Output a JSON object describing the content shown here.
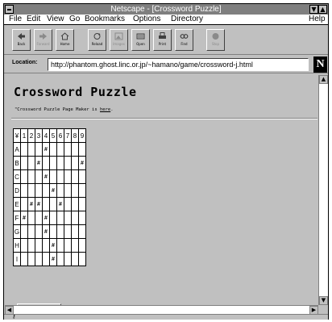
{
  "window": {
    "title": "Netscape - [Crossword Puzzle]"
  },
  "menu": [
    "File",
    "Edit",
    "View",
    "Go",
    "Bookmarks",
    "Options",
    "Directory",
    "Help"
  ],
  "toolbar": [
    {
      "label": "Back",
      "icon": "back-arrow-icon",
      "enabled": true
    },
    {
      "label": "Forward",
      "icon": "forward-arrow-icon",
      "enabled": false
    },
    {
      "label": "Home",
      "icon": "home-icon",
      "enabled": true
    },
    {
      "label": "Reload",
      "icon": "reload-icon",
      "enabled": true
    },
    {
      "label": "Images",
      "icon": "images-icon",
      "enabled": false
    },
    {
      "label": "Open",
      "icon": "open-icon",
      "enabled": true
    },
    {
      "label": "Print",
      "icon": "print-icon",
      "enabled": true
    },
    {
      "label": "Find",
      "icon": "find-icon",
      "enabled": true
    },
    {
      "label": "Stop",
      "icon": "stop-icon",
      "enabled": false
    }
  ],
  "location": {
    "label": "Location:",
    "url": "http://phantom.ghost.linc.or.jp/~hamano/game/crossword-j.html"
  },
  "logo": "N",
  "page": {
    "title": "Crossword Puzzle",
    "note_before": "\"Crossword Puzzle Page Maker is ",
    "note_link": "here",
    "note_after": "."
  },
  "puzzle": {
    "corner": "¥",
    "col_headers": [
      "1",
      "2",
      "3",
      "4",
      "5",
      "6",
      "7",
      "8",
      "9"
    ],
    "rows": [
      {
        "label": "A",
        "cells": [
          "",
          "",
          "",
          "#",
          "",
          "",
          "",
          "",
          ""
        ]
      },
      {
        "label": "B",
        "cells": [
          "",
          "",
          "#",
          "",
          "",
          "",
          "",
          "",
          "#"
        ]
      },
      {
        "label": "C",
        "cells": [
          "",
          "",
          "",
          "#",
          "",
          "",
          "",
          "",
          ""
        ]
      },
      {
        "label": "D",
        "cells": [
          "",
          "",
          "",
          "",
          "#",
          "",
          "",
          "",
          ""
        ]
      },
      {
        "label": "E",
        "cells": [
          "",
          "#",
          "#",
          "",
          "",
          "#",
          "",
          "",
          ""
        ]
      },
      {
        "label": "F",
        "cells": [
          "#",
          "",
          "",
          "#",
          "",
          "",
          "",
          "",
          ""
        ]
      },
      {
        "label": "G",
        "cells": [
          "",
          "",
          "",
          "#",
          "",
          "",
          "",
          "",
          ""
        ]
      },
      {
        "label": "H",
        "cells": [
          "",
          "",
          "",
          "",
          "#",
          "",
          "",
          "",
          ""
        ]
      },
      {
        "label": "I",
        "cells": [
          "",
          "",
          "",
          "",
          "#",
          "",
          "",
          "",
          ""
        ]
      }
    ]
  },
  "colors": {
    "chrome": "#c0c0c0",
    "titlebar": "#7f7f7f",
    "text": "#000000"
  }
}
